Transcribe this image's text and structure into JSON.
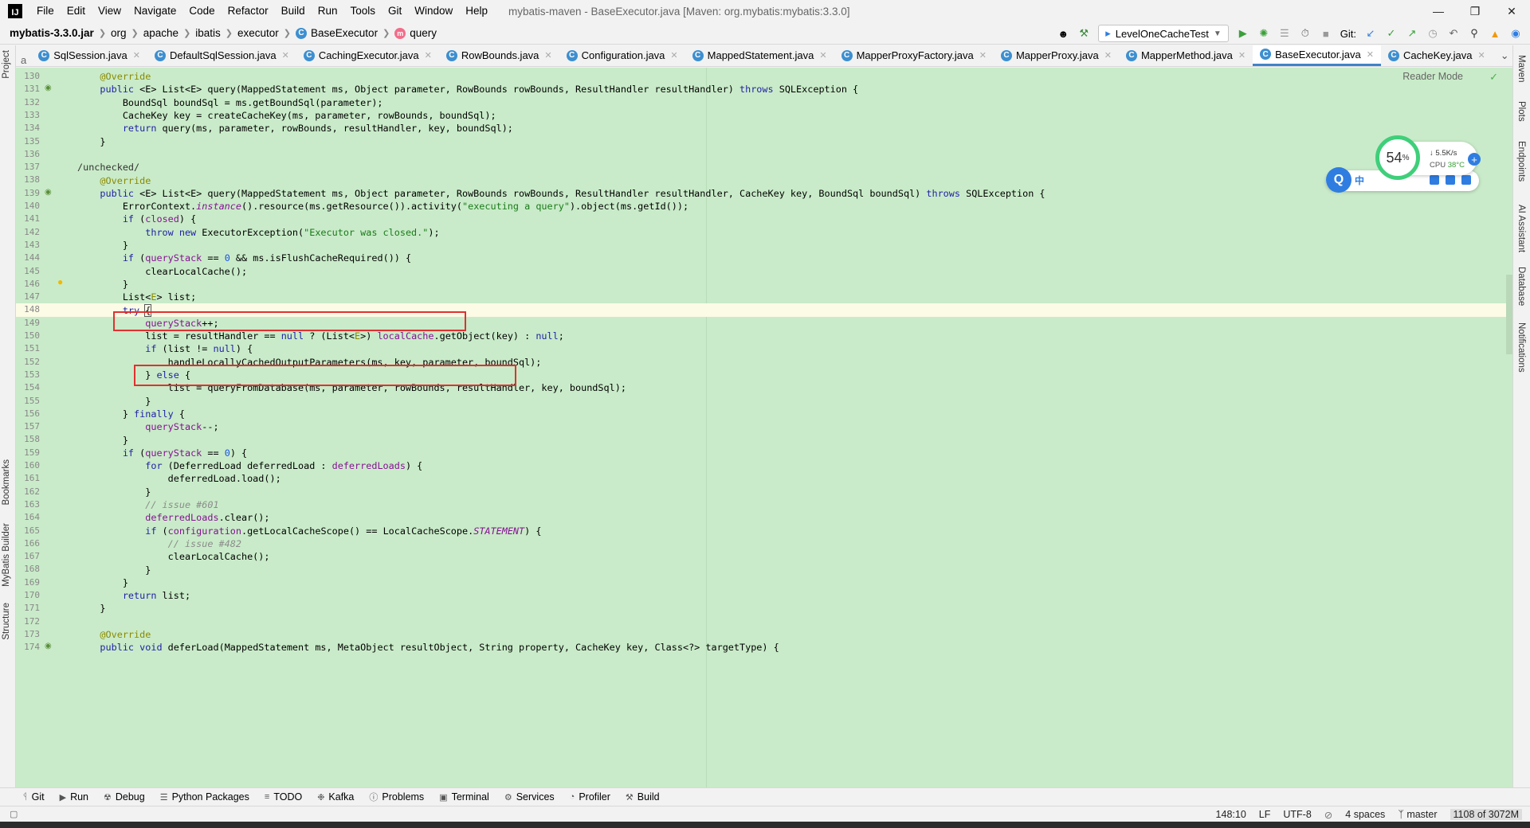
{
  "menu": {
    "items": [
      "File",
      "Edit",
      "View",
      "Navigate",
      "Code",
      "Refactor",
      "Build",
      "Run",
      "Tools",
      "Git",
      "Window",
      "Help"
    ],
    "title": "mybatis-maven - BaseExecutor.java [Maven: org.mybatis:mybatis:3.3.0]"
  },
  "breadcrumb": {
    "root": "mybatis-3.3.0.jar",
    "parts": [
      "org",
      "apache",
      "ibatis",
      "executor"
    ],
    "class": "BaseExecutor",
    "method": "query"
  },
  "toolbar": {
    "run_config": "LevelOneCacheTest",
    "git_label": "Git:"
  },
  "tabs": [
    {
      "label": "SqlSession.java",
      "active": false
    },
    {
      "label": "DefaultSqlSession.java",
      "active": false
    },
    {
      "label": "CachingExecutor.java",
      "active": false
    },
    {
      "label": "RowBounds.java",
      "active": false
    },
    {
      "label": "Configuration.java",
      "active": false
    },
    {
      "label": "MappedStatement.java",
      "active": false
    },
    {
      "label": "MapperProxyFactory.java",
      "active": false
    },
    {
      "label": "MapperProxy.java",
      "active": false
    },
    {
      "label": "MapperMethod.java",
      "active": false
    },
    {
      "label": "BaseExecutor.java",
      "active": true
    },
    {
      "label": "CacheKey.java",
      "active": false
    }
  ],
  "tab_clip": "a",
  "left_tools": {
    "project": "Project",
    "bookmarks": "Bookmarks",
    "mybatis_builder": "MyBatis Builder",
    "structure": "Structure"
  },
  "right_tools": {
    "maven": "Maven",
    "plots": "Plots",
    "endpoints": "Endpoints",
    "ai_assistant": "AI Assistant",
    "database": "Database",
    "notifications": "Notifications"
  },
  "editor": {
    "reader_mode": "Reader Mode",
    "current_line": 148,
    "unchecked_annotation": "/unchecked/"
  },
  "code_lines": [
    {
      "n": "130",
      "html": "    <span class='ann'>@Override</span>"
    },
    {
      "n": "131",
      "html": "    <span class='kw'>public</span> &lt;E&gt; List&lt;E&gt; query(MappedStatement ms, Object parameter, RowBounds rowBounds, ResultHandler resultHandler) <span class='kw'>throws</span> SQLException {"
    },
    {
      "n": "132",
      "html": "        BoundSql boundSql = ms.getBoundSql(parameter);"
    },
    {
      "n": "133",
      "html": "        CacheKey key = createCacheKey(ms, parameter, rowBounds, boundSql);"
    },
    {
      "n": "134",
      "html": "        <span class='kw'>return</span> query(ms, parameter, rowBounds, resultHandler, key, boundSql);"
    },
    {
      "n": "135",
      "html": "    }"
    },
    {
      "n": "136",
      "html": ""
    },
    {
      "n": "137",
      "html": "<span style='color:#333'>/unchecked/</span>"
    },
    {
      "n": "138",
      "html": "    <span class='ann'>@Override</span>"
    },
    {
      "n": "139",
      "html": "    <span class='kw'>public</span> &lt;E&gt; List&lt;E&gt; query(MappedStatement ms, Object parameter, RowBounds rowBounds, ResultHandler resultHandler, CacheKey key, BoundSql boundSql) <span class='kw'>throws</span> SQLException {"
    },
    {
      "n": "140",
      "html": "        ErrorContext.<span class='stat'>instance</span>().resource(ms.getResource()).activity(<span class='str'>\"executing a query\"</span>).object(ms.getId());"
    },
    {
      "n": "141",
      "html": "        <span class='kw'>if</span> (<span class='field'>closed</span>) {"
    },
    {
      "n": "142",
      "html": "            <span class='kw'>throw new</span> ExecutorException(<span class='str'>\"Executor was closed.\"</span>);"
    },
    {
      "n": "143",
      "html": "        }"
    },
    {
      "n": "144",
      "html": "        <span class='kw'>if</span> (<span class='field'>queryStack</span> == <span class='num'>0</span> &amp;&amp; ms.isFlushCacheRequired()) {"
    },
    {
      "n": "145",
      "html": "            clearLocalCache();"
    },
    {
      "n": "146",
      "html": "        }"
    },
    {
      "n": "147",
      "html": "        List&lt;<span class='ann'>E</span>&gt; list;"
    },
    {
      "n": "148",
      "html": "        <span class='kw'>try</span> <span style='outline:1px solid #555'>{</span>"
    },
    {
      "n": "149",
      "html": "            <span class='field'>queryStack</span>++;"
    },
    {
      "n": "150",
      "html": "            list = resultHandler == <span class='kw'>null</span> ? (List&lt;<span class='ann'>E</span>&gt;) <span class='field'>localCache</span>.getObject(key) : <span class='kw'>null</span>;"
    },
    {
      "n": "151",
      "html": "            <span class='kw'>if</span> (list != <span class='kw'>null</span>) {"
    },
    {
      "n": "152",
      "html": "                handleLocallyCachedOutputParameters(ms, key, parameter, boundSql);"
    },
    {
      "n": "153",
      "html": "            } <span class='kw'>else</span> {"
    },
    {
      "n": "154",
      "html": "                list = queryFromDatabase(ms, parameter, rowBounds, resultHandler, key, boundSql);"
    },
    {
      "n": "155",
      "html": "            }"
    },
    {
      "n": "156",
      "html": "        } <span class='kw'>finally</span> {"
    },
    {
      "n": "157",
      "html": "            <span class='field'>queryStack</span>--;"
    },
    {
      "n": "158",
      "html": "        }"
    },
    {
      "n": "159",
      "html": "        <span class='kw'>if</span> (<span class='field'>queryStack</span> == <span class='num'>0</span>) {"
    },
    {
      "n": "160",
      "html": "            <span class='kw'>for</span> (DeferredLoad deferredLoad : <span class='field'>deferredLoads</span>) {"
    },
    {
      "n": "161",
      "html": "                deferredLoad.load();"
    },
    {
      "n": "162",
      "html": "            }"
    },
    {
      "n": "163",
      "html": "            <span class='cmt'>// issue #601</span>"
    },
    {
      "n": "164",
      "html": "            <span class='field'>deferredLoads</span>.clear();"
    },
    {
      "n": "165",
      "html": "            <span class='kw'>if</span> (<span class='field'>configuration</span>.getLocalCacheScope() == LocalCacheScope.<span class='stat'>STATEMENT</span>) {"
    },
    {
      "n": "166",
      "html": "                <span class='cmt'>// issue #482</span>"
    },
    {
      "n": "167",
      "html": "                clearLocalCache();"
    },
    {
      "n": "168",
      "html": "            }"
    },
    {
      "n": "169",
      "html": "        }"
    },
    {
      "n": "170",
      "html": "        <span class='kw'>return</span> list;"
    },
    {
      "n": "171",
      "html": "    }"
    },
    {
      "n": "172",
      "html": ""
    },
    {
      "n": "173",
      "html": "    <span class='ann'>@Override</span>"
    },
    {
      "n": "174",
      "html": "    <span class='kw'>public void</span> deferLoad(MappedStatement ms, MetaObject resultObject, String property, CacheKey key, Class&lt;?&gt; targetType) {"
    }
  ],
  "widget": {
    "cpu_percent": "54",
    "percent_sign": "%",
    "net_speed": "5.5K/s",
    "cpu_label": "CPU",
    "cpu_temp": "38°C",
    "ime_lang": "中"
  },
  "bottom_tools": [
    {
      "label": "Git",
      "icon": "git-branch-icon"
    },
    {
      "label": "Run",
      "icon": "play-icon"
    },
    {
      "label": "Debug",
      "icon": "bug-icon"
    },
    {
      "label": "Python Packages",
      "icon": "layers-icon"
    },
    {
      "label": "TODO",
      "icon": "list-icon"
    },
    {
      "label": "Kafka",
      "icon": "kafka-icon"
    },
    {
      "label": "Problems",
      "icon": "info-icon"
    },
    {
      "label": "Terminal",
      "icon": "terminal-icon"
    },
    {
      "label": "Services",
      "icon": "services-icon"
    },
    {
      "label": "Profiler",
      "icon": "profiler-icon"
    },
    {
      "label": "Build",
      "icon": "hammer-icon"
    }
  ],
  "status": {
    "position": "148:10",
    "line_sep": "LF",
    "encoding": "UTF-8",
    "indent": "4 spaces",
    "branch": "master",
    "memory": "1108 of 3072M"
  },
  "colors": {
    "editor_bg": "#c9ebc9",
    "highlight_box": "#e03131",
    "active_tab": "#4083c9"
  }
}
